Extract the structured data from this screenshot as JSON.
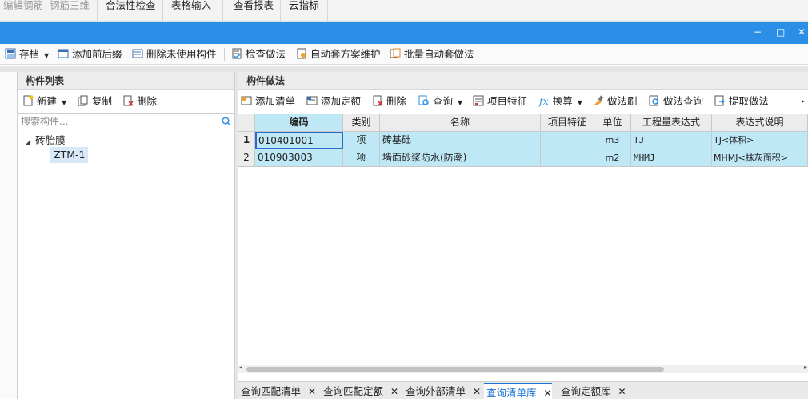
{
  "menu_tabs": [
    {
      "label": "编辑钢筋",
      "disabled": true
    },
    {
      "label": "钢筋三维",
      "disabled": true
    },
    {
      "label": "合法性检查",
      "disabled": false
    },
    {
      "label": "表格输入",
      "disabled": false
    },
    {
      "label": "查看报表",
      "disabled": false
    },
    {
      "label": "云指标",
      "disabled": false
    }
  ],
  "window_buttons": {
    "minimize": "−",
    "maximize": "□",
    "close": "✕"
  },
  "toolbar": {
    "archive": "存档",
    "add_prefix_suffix": "添加前后缀",
    "delete_unused": "删除未使用构件",
    "check_method": "检查做法",
    "auto_scheme": "自动套方案维护",
    "batch_auto": "批量自动套做法"
  },
  "component_list": {
    "title": "构件列表",
    "new": "新建",
    "copy": "复制",
    "delete": "删除",
    "search_placeholder": "搜索构件...",
    "tree": {
      "group": "砖胎膜",
      "items": [
        "ZTM-1"
      ]
    }
  },
  "method_panel": {
    "title": "构件做法",
    "tools": {
      "add_list": "添加清单",
      "add_quota": "添加定额",
      "delete": "删除",
      "query": "查询",
      "item_feature": "项目特征",
      "convert": "换算",
      "method_brush": "做法刷",
      "method_query": "做法查询",
      "extract_method": "提取做法"
    },
    "columns": [
      "编码",
      "类别",
      "名称",
      "项目特征",
      "单位",
      "工程量表达式",
      "表达式说明"
    ],
    "rows": [
      {
        "num": "1",
        "code": "010401001",
        "type": "项",
        "name": "砖基础",
        "feature": "",
        "unit": "m3",
        "expr": "TJ",
        "desc": "TJ<体积>"
      },
      {
        "num": "2",
        "code": "010903003",
        "type": "项",
        "name": "墙面砂浆防水(防潮)",
        "feature": "",
        "unit": "m2",
        "expr": "MHMJ",
        "desc": "MHMJ<抹灰面积>"
      }
    ]
  },
  "bottom_tabs": [
    {
      "label": "查询匹配清单",
      "active": false
    },
    {
      "label": "查询匹配定额",
      "active": false
    },
    {
      "label": "查询外部清单",
      "active": false
    },
    {
      "label": "查询清单库",
      "active": true
    },
    {
      "label": "查询定额库",
      "active": false
    }
  ],
  "colors": {
    "title_bar": "#2b8fe8",
    "selection": "#bfe8f7",
    "active_tab": "#1a73d6"
  }
}
